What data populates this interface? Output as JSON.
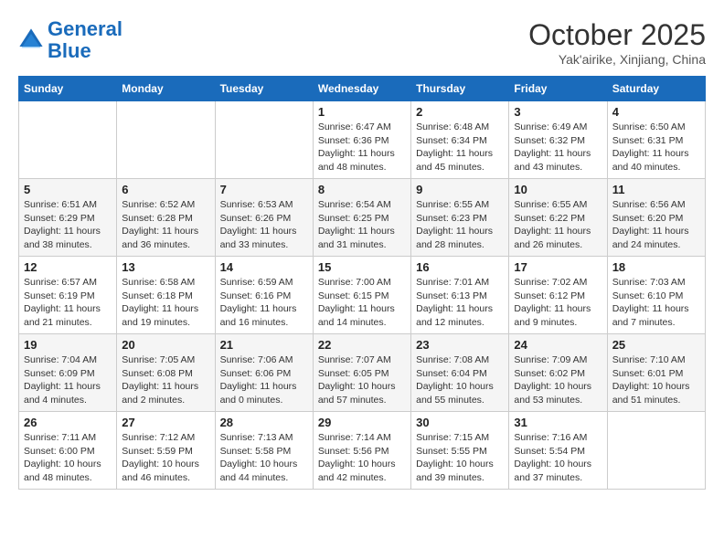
{
  "header": {
    "logo_line1": "General",
    "logo_line2": "Blue",
    "month": "October 2025",
    "location": "Yak'airike, Xinjiang, China"
  },
  "days_of_week": [
    "Sunday",
    "Monday",
    "Tuesday",
    "Wednesday",
    "Thursday",
    "Friday",
    "Saturday"
  ],
  "weeks": [
    [
      {
        "num": "",
        "info": ""
      },
      {
        "num": "",
        "info": ""
      },
      {
        "num": "",
        "info": ""
      },
      {
        "num": "1",
        "info": "Sunrise: 6:47 AM\nSunset: 6:36 PM\nDaylight: 11 hours and 48 minutes."
      },
      {
        "num": "2",
        "info": "Sunrise: 6:48 AM\nSunset: 6:34 PM\nDaylight: 11 hours and 45 minutes."
      },
      {
        "num": "3",
        "info": "Sunrise: 6:49 AM\nSunset: 6:32 PM\nDaylight: 11 hours and 43 minutes."
      },
      {
        "num": "4",
        "info": "Sunrise: 6:50 AM\nSunset: 6:31 PM\nDaylight: 11 hours and 40 minutes."
      }
    ],
    [
      {
        "num": "5",
        "info": "Sunrise: 6:51 AM\nSunset: 6:29 PM\nDaylight: 11 hours and 38 minutes."
      },
      {
        "num": "6",
        "info": "Sunrise: 6:52 AM\nSunset: 6:28 PM\nDaylight: 11 hours and 36 minutes."
      },
      {
        "num": "7",
        "info": "Sunrise: 6:53 AM\nSunset: 6:26 PM\nDaylight: 11 hours and 33 minutes."
      },
      {
        "num": "8",
        "info": "Sunrise: 6:54 AM\nSunset: 6:25 PM\nDaylight: 11 hours and 31 minutes."
      },
      {
        "num": "9",
        "info": "Sunrise: 6:55 AM\nSunset: 6:23 PM\nDaylight: 11 hours and 28 minutes."
      },
      {
        "num": "10",
        "info": "Sunrise: 6:55 AM\nSunset: 6:22 PM\nDaylight: 11 hours and 26 minutes."
      },
      {
        "num": "11",
        "info": "Sunrise: 6:56 AM\nSunset: 6:20 PM\nDaylight: 11 hours and 24 minutes."
      }
    ],
    [
      {
        "num": "12",
        "info": "Sunrise: 6:57 AM\nSunset: 6:19 PM\nDaylight: 11 hours and 21 minutes."
      },
      {
        "num": "13",
        "info": "Sunrise: 6:58 AM\nSunset: 6:18 PM\nDaylight: 11 hours and 19 minutes."
      },
      {
        "num": "14",
        "info": "Sunrise: 6:59 AM\nSunset: 6:16 PM\nDaylight: 11 hours and 16 minutes."
      },
      {
        "num": "15",
        "info": "Sunrise: 7:00 AM\nSunset: 6:15 PM\nDaylight: 11 hours and 14 minutes."
      },
      {
        "num": "16",
        "info": "Sunrise: 7:01 AM\nSunset: 6:13 PM\nDaylight: 11 hours and 12 minutes."
      },
      {
        "num": "17",
        "info": "Sunrise: 7:02 AM\nSunset: 6:12 PM\nDaylight: 11 hours and 9 minutes."
      },
      {
        "num": "18",
        "info": "Sunrise: 7:03 AM\nSunset: 6:10 PM\nDaylight: 11 hours and 7 minutes."
      }
    ],
    [
      {
        "num": "19",
        "info": "Sunrise: 7:04 AM\nSunset: 6:09 PM\nDaylight: 11 hours and 4 minutes."
      },
      {
        "num": "20",
        "info": "Sunrise: 7:05 AM\nSunset: 6:08 PM\nDaylight: 11 hours and 2 minutes."
      },
      {
        "num": "21",
        "info": "Sunrise: 7:06 AM\nSunset: 6:06 PM\nDaylight: 11 hours and 0 minutes."
      },
      {
        "num": "22",
        "info": "Sunrise: 7:07 AM\nSunset: 6:05 PM\nDaylight: 10 hours and 57 minutes."
      },
      {
        "num": "23",
        "info": "Sunrise: 7:08 AM\nSunset: 6:04 PM\nDaylight: 10 hours and 55 minutes."
      },
      {
        "num": "24",
        "info": "Sunrise: 7:09 AM\nSunset: 6:02 PM\nDaylight: 10 hours and 53 minutes."
      },
      {
        "num": "25",
        "info": "Sunrise: 7:10 AM\nSunset: 6:01 PM\nDaylight: 10 hours and 51 minutes."
      }
    ],
    [
      {
        "num": "26",
        "info": "Sunrise: 7:11 AM\nSunset: 6:00 PM\nDaylight: 10 hours and 48 minutes."
      },
      {
        "num": "27",
        "info": "Sunrise: 7:12 AM\nSunset: 5:59 PM\nDaylight: 10 hours and 46 minutes."
      },
      {
        "num": "28",
        "info": "Sunrise: 7:13 AM\nSunset: 5:58 PM\nDaylight: 10 hours and 44 minutes."
      },
      {
        "num": "29",
        "info": "Sunrise: 7:14 AM\nSunset: 5:56 PM\nDaylight: 10 hours and 42 minutes."
      },
      {
        "num": "30",
        "info": "Sunrise: 7:15 AM\nSunset: 5:55 PM\nDaylight: 10 hours and 39 minutes."
      },
      {
        "num": "31",
        "info": "Sunrise: 7:16 AM\nSunset: 5:54 PM\nDaylight: 10 hours and 37 minutes."
      },
      {
        "num": "",
        "info": ""
      }
    ]
  ]
}
